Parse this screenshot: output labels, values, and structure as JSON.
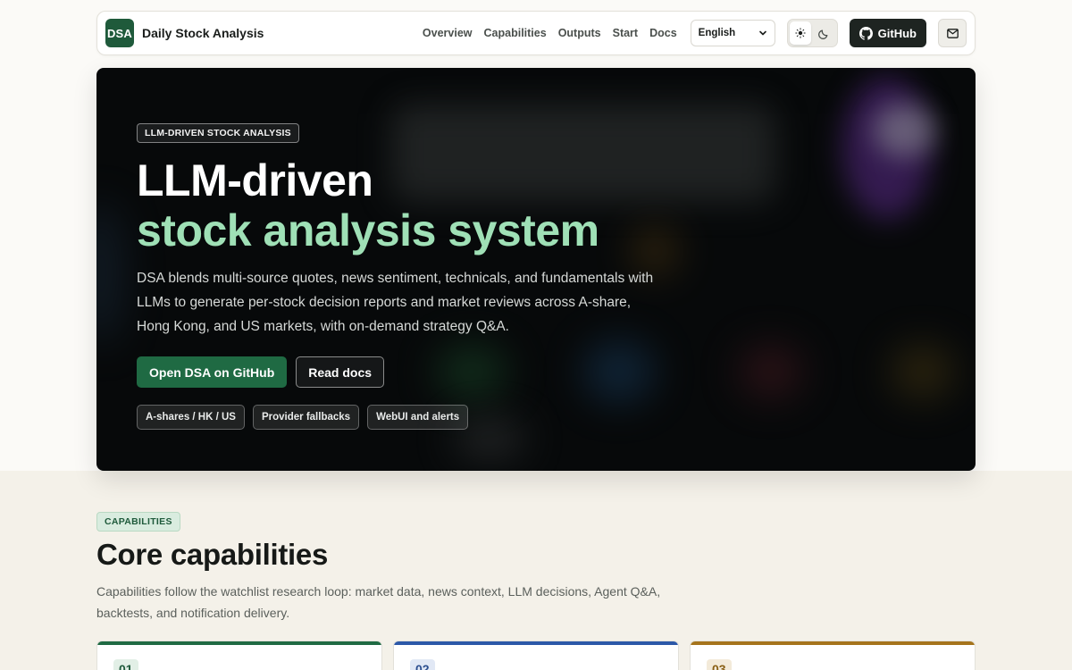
{
  "nav": {
    "logo_text": "DSA",
    "brand": "Daily Stock Analysis",
    "links": [
      "Overview",
      "Capabilities",
      "Outputs",
      "Start",
      "Docs"
    ],
    "language": "English",
    "github_label": "GitHub"
  },
  "hero": {
    "eyebrow": "LLM-DRIVEN STOCK ANALYSIS",
    "title_line1": "LLM-driven",
    "title_line2": "stock analysis system",
    "description": "DSA blends multi-source quotes, news sentiment, technicals, and fundamentals with LLMs to generate per-stock decision reports and market reviews across A-share, Hong Kong, and US markets, with on-demand strategy Q&A.",
    "primary_button": "Open DSA on GitHub",
    "secondary_button": "Read docs",
    "chips": [
      "A-shares / HK / US",
      "Provider fallbacks",
      "WebUI and alerts"
    ]
  },
  "capabilities": {
    "tag": "CAPABILITIES",
    "title": "Core capabilities",
    "description": "Capabilities follow the watchlist research loop: market data, news context, LLM decisions, Agent Q&A, backtests, and notification delivery.",
    "cards": [
      {
        "num": "01",
        "color": "#1f6a43",
        "numBg": "#e2efe6",
        "numColor": "#1f5a3b"
      },
      {
        "num": "02",
        "color": "#2c58a8",
        "numBg": "#e1e8f5",
        "numColor": "#2c4f8f"
      },
      {
        "num": "03",
        "color": "#a5741c",
        "numBg": "#f3ead9",
        "numColor": "#8a5f14"
      }
    ]
  },
  "colors": {
    "accent": "#1f6a43",
    "hero_highlight": "#9fe0b6",
    "hero_bg": "#07090a",
    "page_bg": "#f4f1e9"
  }
}
